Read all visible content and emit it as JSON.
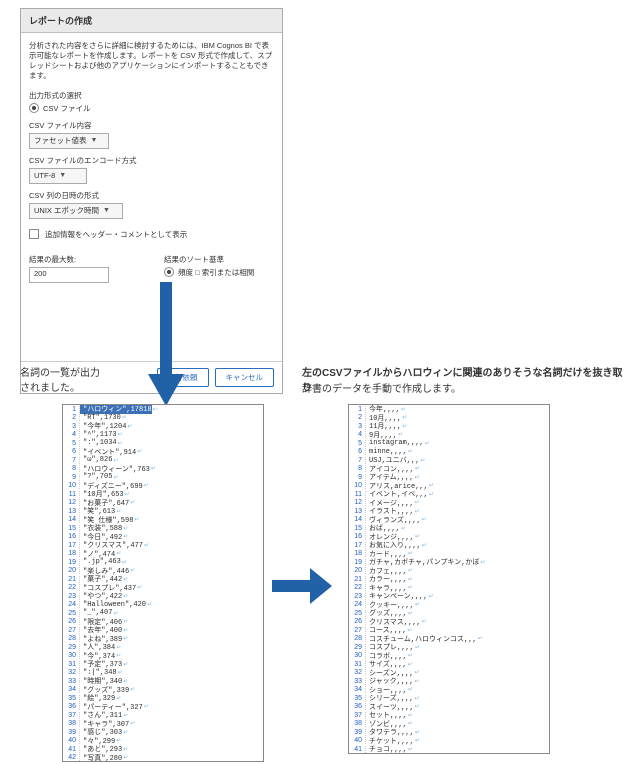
{
  "dialog": {
    "title": "レポートの作成",
    "description": "分析された内容をさらに詳細に検討するためには、IBM Cognos BI で表示可能なレポートを作成します。レポートを CSV 形式で作成して、スプレッドシートおよび他のアプリケーションにインポートすることもできます。",
    "output_format_label": "出力形式の選択",
    "output_format_option": "CSV ファイル",
    "csv_content_label": "CSV ファイル内容",
    "csv_content_value": "ファセット値表",
    "encoding_label": "CSV ファイルのエンコード方式",
    "encoding_value": "UTF-8",
    "date_format_label": "CSV 列の日時の形式",
    "date_format_value": "UNIX エポック時間",
    "checkbox_label": "追加情報をヘッダー・コメントとして表示",
    "max_results_label": "結果の最大数:",
    "max_results_value": "200",
    "sort_label": "結果のソート基準",
    "sort_option": "頻度 □ 索引または相関",
    "submit": "実行依頼",
    "cancel": "キャンセル"
  },
  "captions": {
    "left1": "名詞の一覧が出力",
    "left2": "されました。",
    "right_bold": "左のCSVファイルからハロウィンに関連のありそうな名詞だけを抜き取り",
    "right2": "辞書のデータを手動で作成します。"
  },
  "left_list": [
    "\"ハロウィン\",17818",
    "\"RT\",1730",
    "\"今年\",1204",
    "\"^\",1173",
    "\":\",1034",
    "\"イベント\",914",
    "\"ω\",826",
    "\"ハロウィーン\",763",
    "\"?\",705",
    "\"ディズニー\",699",
    "\"10月\",653",
    "\"お菓子\",647",
    "\"笑\",613",
    "\"笑 仕様\",598",
    "\"衣装\",588",
    "\"今日\",492",
    "\"クリスマス\",477",
    "\"ノ\",474",
    "\".jp\",463",
    "\"楽しみ\",446",
    "\"菓子\",442",
    "\"コスプレ\",437",
    "\"やつ\",422",
    "\"Halloween\",420",
    "\"_\",407",
    "\"限定\",406",
    "\"去年\",400",
    "\"よね\",389",
    "\"人\",384",
    "\"今\",374",
    "\"予定\",373",
    "\":|\",348",
    "\"時期\",340",
    "\"グッズ\",339",
    "\"絵\",329",
    "\"パーティー\",327",
    "\"さん\",311",
    "\"キャラ\",307",
    "\"感じ\",303",
    "\"々\",299",
    "\"あと\",293",
    "\"写真\",280"
  ],
  "right_list": [
    "今年,,,,",
    "10月,,,,",
    "11月,,,,",
    "9月,,,,",
    "instagram,,,,",
    "minne,,,,",
    "USJ,ユニバ,,,",
    "アイコン,,,,",
    "アイテム,,,,",
    "アリス,arice,,,",
    "イベント,イベ,,,",
    "イメージ,,,,",
    "イラスト,,,,",
    "ヴィランズ,,,,",
    "おば,,,,",
    "オレンジ,,,,",
    "お気に入り,,,,",
    "カード,,,,",
    "ガチャ,カボチャ,パンプキン,かぼ",
    "カフェ,,,,",
    "カラー,,,,",
    "キャラ,,,,",
    "キャンペーン,,,,",
    "クッキー,,,,",
    "グッズ,,,,",
    "クリスマス,,,,",
    "コース,,,,",
    "コスチューム,ハロウィンコス,,,",
    "コスプレ,,,,",
    "コラボ,,,,",
    "サイズ,,,,",
    "シーズン,,,,",
    "ジャック,,,,",
    "ショー,,,,",
    "シリーズ,,,,",
    "スイーツ,,,,",
    "セット,,,,",
    "ゾンビ,,,,",
    "タワテラ,,,,",
    "チケット,,,,",
    "チョコ,,,,"
  ]
}
